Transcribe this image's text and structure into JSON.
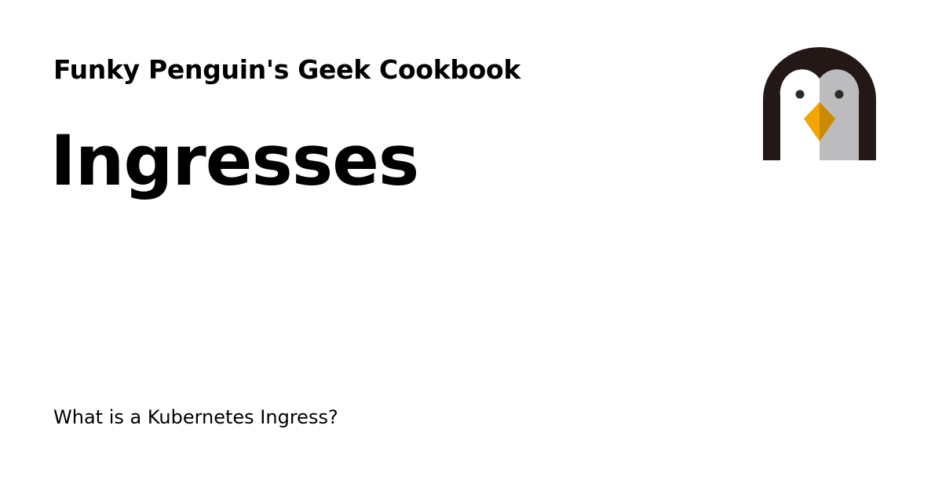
{
  "header": {
    "site_title": "Funky Penguin's Geek Cookbook"
  },
  "main": {
    "page_title": "Ingresses",
    "description": "What is a Kubernetes Ingress?"
  },
  "logo": {
    "icon": "penguin-logo-icon",
    "colors": {
      "outline": "#231815",
      "face_left": "#ffffff",
      "face_right": "#bcbcbe",
      "eyes": "#2b2b2b",
      "beak_light": "#f4a400",
      "beak_dark": "#c98a00"
    }
  }
}
